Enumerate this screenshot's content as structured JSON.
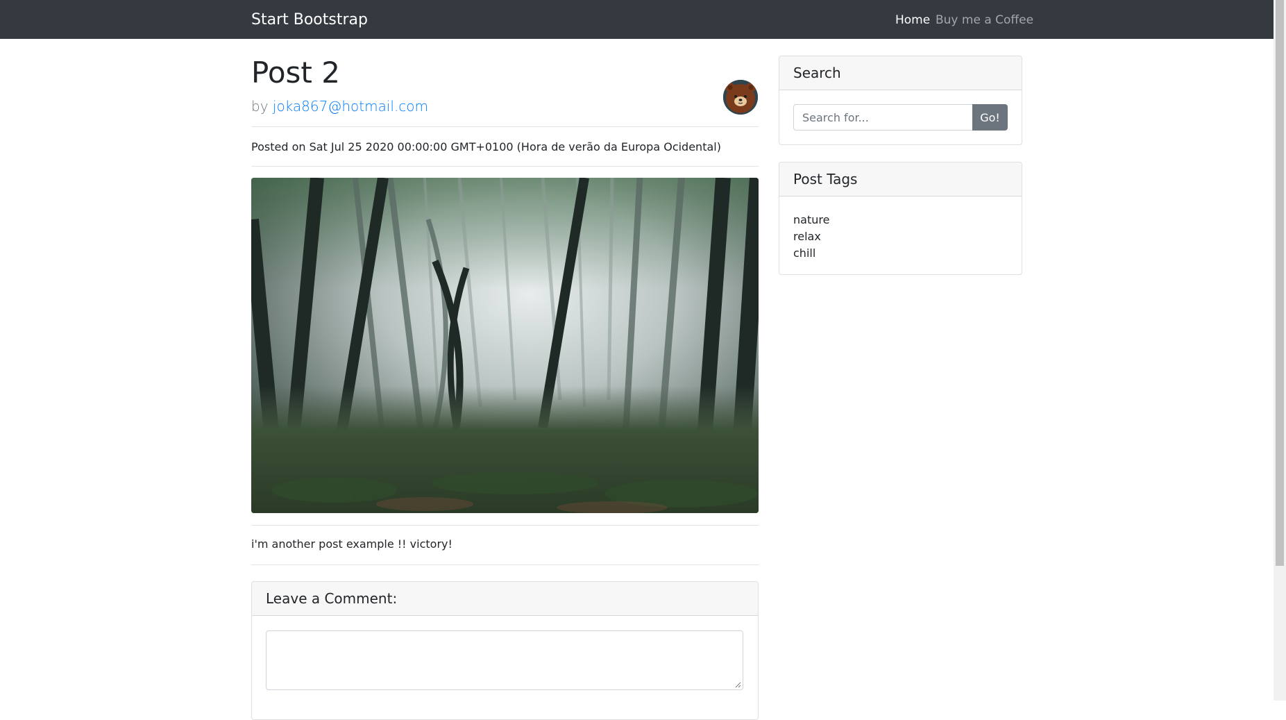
{
  "navbar": {
    "brand": "Start Bootstrap",
    "links": [
      {
        "label": "Home",
        "active": true
      },
      {
        "label": "Buy me a Coffee",
        "active": false
      }
    ]
  },
  "post": {
    "title": "Post 2",
    "by_prefix": "by",
    "author": "joka867@hotmail.com",
    "posted": "Posted on Sat Jul 25 2020 00:00:00 GMT+0100 (Hora de verão da Europa Ocidental)",
    "body": "i'm another post example !! victory!"
  },
  "comment": {
    "header": "Leave a Comment:",
    "value": ""
  },
  "sidebar": {
    "search": {
      "header": "Search",
      "placeholder": "Search for...",
      "button_label": "Go!"
    },
    "tags": {
      "header": "Post Tags",
      "items": [
        "nature",
        "relax",
        "chill"
      ]
    }
  },
  "colors": {
    "navbar": "#343a40",
    "link": "#007bff",
    "button": "#6c757d"
  },
  "icons": {
    "avatar": "bear-avatar-icon",
    "photo": "misty-forest-photo"
  }
}
